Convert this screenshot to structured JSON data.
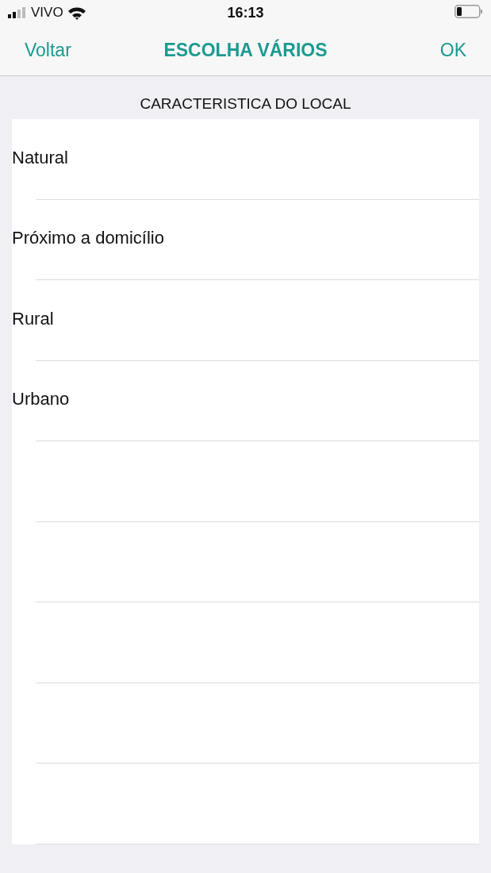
{
  "status_bar": {
    "carrier": "VIVO",
    "time": "16:13"
  },
  "nav": {
    "back": "Voltar",
    "title": "ESCOLHA VÁRIOS",
    "done": "OK"
  },
  "section": {
    "header": "CARACTERISTICA DO LOCAL",
    "items": [
      {
        "label": "Natural",
        "selected": false
      },
      {
        "label": "Próximo a domicílio",
        "selected": false
      },
      {
        "label": "Rural",
        "selected": false
      },
      {
        "label": "Urbano",
        "selected": false
      }
    ]
  }
}
